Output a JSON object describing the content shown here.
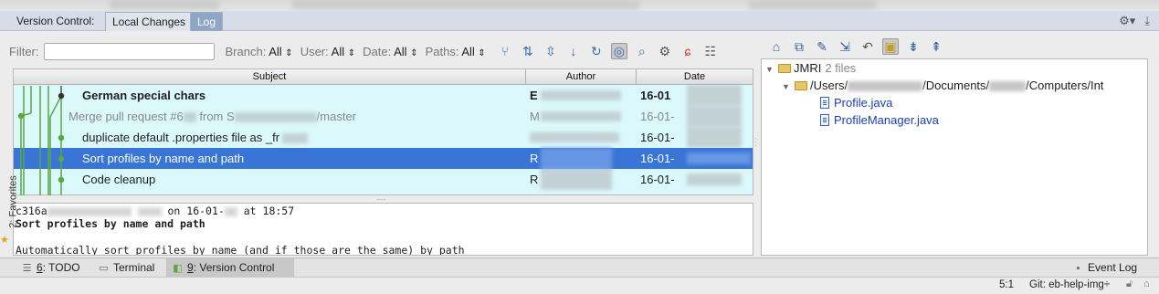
{
  "tool_window": {
    "title": "Version Control:",
    "tabs": [
      {
        "label": "Local Changes",
        "active": false
      },
      {
        "label": "Log",
        "active": true
      }
    ],
    "settings_icon": "gear-icon",
    "hide_icon": "hide-panel-icon"
  },
  "filters": {
    "filter_label": "Filter:",
    "filter_value": "",
    "filter_placeholder": "",
    "branch_label": "Branch:",
    "branch_value": "All",
    "user_label": "User:",
    "user_value": "All",
    "date_label": "Date:",
    "date_value": "All",
    "paths_label": "Paths:",
    "paths_value": "All",
    "toolbar_icons": [
      "cherry-pick-graph-icon",
      "branches-icon",
      "collapse-icon",
      "arrow-down-icon",
      "refresh-icon",
      "preview-icon",
      "zoom-icon",
      "settings-icon",
      "cherry-icon",
      "people-icon"
    ]
  },
  "log": {
    "columns": [
      "Subject",
      "Author",
      "Date"
    ],
    "rows": [
      {
        "subject": "German special chars",
        "author": "E",
        "date": "16-01",
        "bold": true,
        "muted": false,
        "selected": false
      },
      {
        "subject": "Merge pull request #6",
        "subject_tail": "from S",
        "subject_end": "/master",
        "author": "M",
        "date": "16-01-",
        "bold": false,
        "muted": true,
        "selected": false
      },
      {
        "subject": "duplicate default .properties file as _fr",
        "author": "",
        "date": "16-01-",
        "bold": false,
        "muted": false,
        "selected": false
      },
      {
        "subject": "Sort profiles by name and path",
        "author": "R",
        "date": "16-01-",
        "bold": false,
        "muted": false,
        "selected": true
      },
      {
        "subject": "Code cleanup",
        "author": "R",
        "date": "16-01-",
        "bold": false,
        "muted": false,
        "selected": false
      }
    ]
  },
  "details": {
    "hash_prefix": "c316a",
    "meta_on": "on 16-01-",
    "meta_time": "at 18:57",
    "title": "Sort profiles by name and path",
    "body": "Automatically sort profiles by name (and if those are the same) by path"
  },
  "tree": {
    "root_label": "JMRI",
    "root_count": "2 files",
    "path_users": "/Users/",
    "path_documents": "/Documents/",
    "path_computers": "/Computers/Int",
    "files": [
      "Profile.java",
      "ProfileManager.java"
    ],
    "toolbar_icons": [
      "commit-icon",
      "diff-icon",
      "edit-icon",
      "move-icon",
      "revert-icon",
      "group-by-directory-icon",
      "expand-all-icon",
      "collapse-all-icon"
    ]
  },
  "favorites": {
    "label": "2: Favorites"
  },
  "bottom_bar": {
    "todo": {
      "num": "6",
      "label": ": TODO"
    },
    "terminal": {
      "label": "Terminal"
    },
    "vcs": {
      "num": "9",
      "label": ": Version Control"
    },
    "event_log": {
      "label": "Event Log"
    }
  },
  "status": {
    "position": "5:1",
    "git": "Git: eb-help-img",
    "git_arrow": "÷"
  },
  "colors": {
    "log_background": "#dbf8fb",
    "selected_row": "#3875d7",
    "graph_green": "#5aa641",
    "active_tab": "#8fa6c6"
  }
}
